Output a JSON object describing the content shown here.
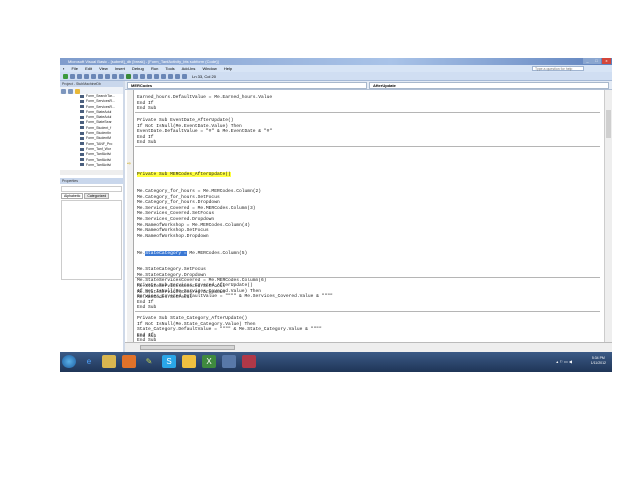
{
  "window": {
    "title": "Microsoft Visual Basic - [submit]_db [break] - [Form_TanfActivity_bts subform (Code)]",
    "help_placeholder": "Type a question for help"
  },
  "menu": [
    "File",
    "Edit",
    "View",
    "Insert",
    "Debug",
    "Run",
    "Tools",
    "Add-Ins",
    "Window",
    "Help"
  ],
  "toolbar": {
    "position": "Ln 33, Col 20"
  },
  "project": {
    "title": "Project - StubMachineDb",
    "items": [
      "Form_SearchTar...",
      "Form_ServicesR...",
      "Form_ServicesR...",
      "Form_StateAdul",
      "Form_StateAdul",
      "Form_StateSear",
      "Form_Student_f",
      "Form_StudentIn",
      "Form_StudentM",
      "Form_TANF_Pro",
      "Form_Tanf_Wor",
      "Form_TanfActivi",
      "Form_TanfActivi",
      "Form_TanfActivi"
    ]
  },
  "properties": {
    "title": "Properties",
    "tabs": [
      "Alphabetic",
      "Categorized"
    ]
  },
  "code": {
    "object_combo": "MERCodes",
    "proc_combo": "AfterUpdate",
    "block1": [
      "Earned_hours.DefaultValue = Me.Earned_hours.Value",
      "End If",
      "End Sub"
    ],
    "block2": [
      "Private Sub EventDate_AfterUpdate()",
      "If Not IsNull(Me.EventDate.Value) Then",
      "EventDate.DefaultValue = \"#\" & Me.EventDate & \"#\"",
      "End If",
      "End Sub"
    ],
    "block3_head": "Private Sub MERCodes_AfterUpdate()",
    "block3a": [
      "Me.Category_for_hours = Me.MERCodes.Column(2)",
      "Me.Category_for_hours.SetFocus",
      "Me.Category_for_hours.Dropdown",
      "Me.Services_Covered = Me.MERCodes.Column(3)",
      "Me.Services_Covered.SetFocus",
      "Me.Services_Covered.Dropdown",
      "Me.NameofWorkshop = Me.MERCodes.Column(4)",
      "Me.NameofWorkshop.SetFocus",
      "Me.NameofWorkshop.Dropdown"
    ],
    "sel_prefix": "Me.",
    "sel_text": "StateCategory =",
    "sel_suffix": " Me.MERCodes.Column(5)",
    "block3b": [
      "Me.StateCategory.SetFocus",
      "Me.StateCategory.Dropdown",
      "Me.StateServicesCovered = Me.MERCodes.Column(6)",
      "Me.StateServicesCovered.SetFocus",
      "Me.StateServicesCovered.Dropdown",
      "Me.MERCodes.SetFocus"
    ],
    "block3_end": "End Sub",
    "block4": [
      "Private Sub Services_Covered_AfterUpdate()",
      "If Not IsNull(Me.Services_Covered.Value) Then",
      "Services_Covered.DefaultValue = \"\"\"\" & Me.Services_Covered.Value & \"\"\"\"",
      "End If",
      "End Sub"
    ],
    "block5": [
      "Private Sub State_Category_AfterUpdate()",
      "If Not IsNull(Me.State_Category.Value) Then",
      "State_Category.DefaultValue = \"\"\"\" & Me.State_Category.Value & \"\"\"\"",
      "End If",
      "End Sub"
    ]
  },
  "taskbar": {
    "time": "5:34 PM",
    "date": "1/11/2012"
  }
}
